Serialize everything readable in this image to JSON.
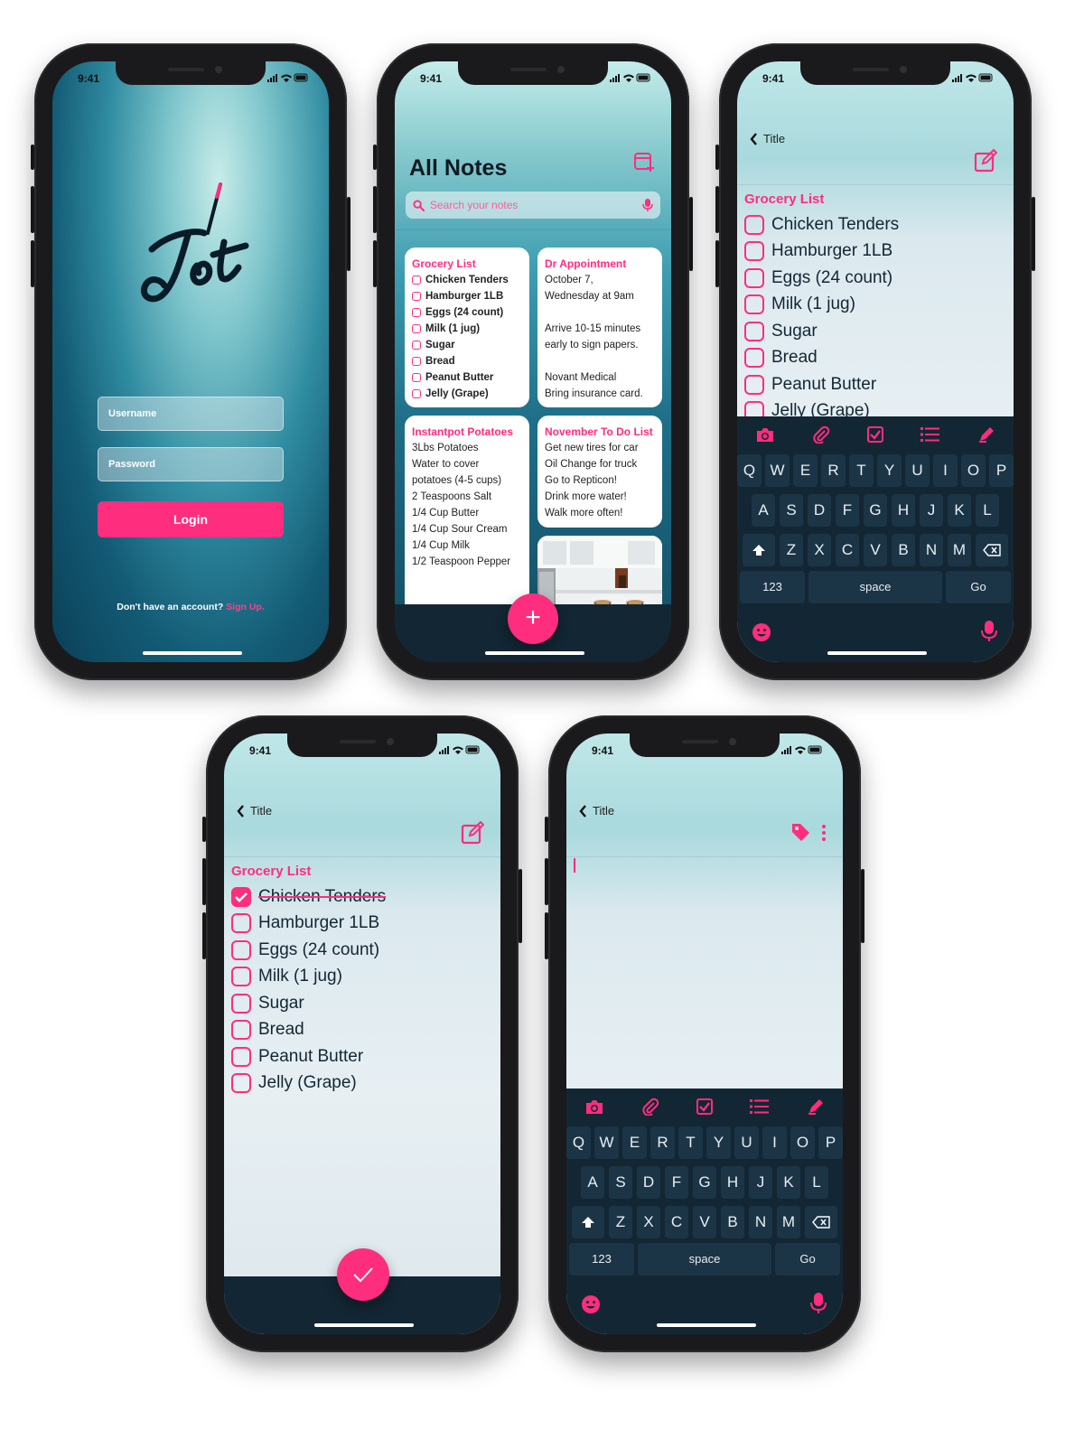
{
  "status": {
    "time": "9:41"
  },
  "login": {
    "username_placeholder": "Username",
    "password_placeholder": "Password",
    "login_label": "Login",
    "signup_prompt": "Don't have an account?",
    "signup_link": "Sign Up."
  },
  "all_notes": {
    "title": "All Notes",
    "search_placeholder": "Search your notes",
    "cards": [
      {
        "title": "Grocery List",
        "items": [
          "Chicken Tenders",
          "Hamburger 1LB",
          "Eggs (24 count)",
          "Milk (1 jug)",
          "Sugar",
          "Bread",
          "Peanut Butter",
          "Jelly (Grape)"
        ]
      },
      {
        "title": "Dr Appointment",
        "lines": [
          "October 7,",
          "Wednesday at 9am",
          "",
          "Arrive 10-15 minutes",
          "early to sign papers.",
          "",
          "Novant Medical",
          "Bring insurance card."
        ]
      },
      {
        "title": "Instantpot Potatoes",
        "lines": [
          "3Lbs Potatoes",
          "Water to cover",
          "potatoes (4-5 cups)",
          "2 Teaspoons Salt",
          "1/4 Cup Butter",
          "1/4 Cup Sour Cream",
          "1/4 Cup Milk",
          "1/2 Teaspoon Pepper"
        ]
      },
      {
        "title": "November To Do List",
        "lines": [
          "Get new tires for car",
          "Oil Change for truck",
          "Go to Repticon!",
          "Drink more water!",
          "Walk more often!"
        ]
      }
    ],
    "fab": "+"
  },
  "editor": {
    "back_label": "Title",
    "list_title": "Grocery List",
    "items": [
      "Chicken Tenders",
      "Hamburger 1LB",
      "Eggs (24 count)",
      "Milk (1 jug)",
      "Sugar",
      "Bread",
      "Peanut Butter",
      "Jelly (Grape)"
    ]
  },
  "keyboard": {
    "row1": [
      "Q",
      "W",
      "E",
      "R",
      "T",
      "Y",
      "U",
      "I",
      "O",
      "P"
    ],
    "row2": [
      "A",
      "S",
      "D",
      "F",
      "G",
      "H",
      "J",
      "K",
      "L"
    ],
    "row3": [
      "Z",
      "X",
      "C",
      "V",
      "B",
      "N",
      "M"
    ],
    "numbers": "123",
    "space": "space",
    "go": "Go"
  },
  "colors": {
    "accent": "#ff2d7e",
    "dark": "#132634"
  }
}
